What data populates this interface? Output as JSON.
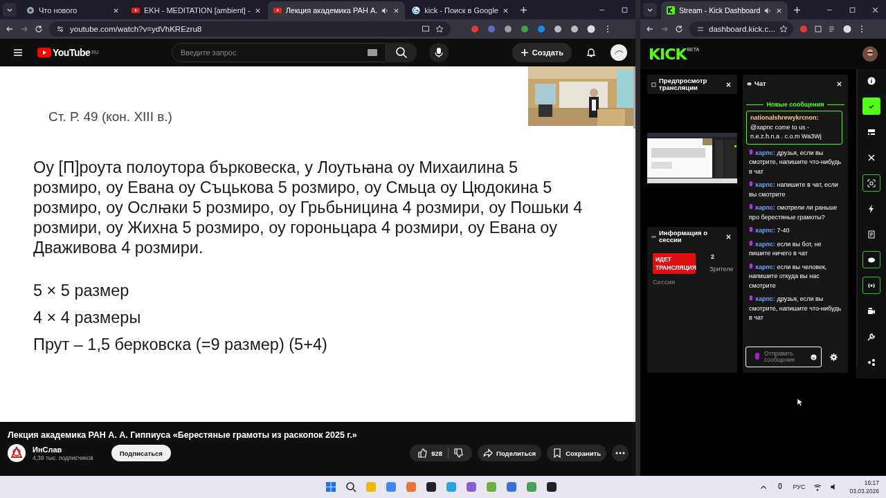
{
  "left_browser": {
    "tabs": [
      {
        "title": "Что нового",
        "selected": false,
        "audio": false,
        "kind": "chrome"
      },
      {
        "title": "EKH - MEDITATION [ambient] -",
        "selected": false,
        "audio": false,
        "kind": "youtube"
      },
      {
        "title": "Лекция академика РАН А.",
        "selected": true,
        "audio": true,
        "kind": "youtube"
      },
      {
        "title": "kick - Поиск в Google",
        "selected": false,
        "audio": false,
        "kind": "google"
      }
    ],
    "address": "youtube.com/watch?v=ydVhKREzru8"
  },
  "youtube": {
    "logo": "YouTube",
    "region": "RU",
    "search": {
      "placeholder": "Введите запрос"
    },
    "create_button": "Создать"
  },
  "slide": {
    "heading": "Ст. Р. 49 (кон. XIII в.)",
    "paragraph": "Оу [П]роута полоутора бърковеска, у Лоутьꙗна оу Михаилина 5 розмиро, оу Евана оу Съцькова 5 розмиро, оу Смьца оу Цюдокина 5 розмиро, оу Ослꙗки 5 розмиро, оу Грьбьницина 4 розмири, оу Пошьки 4 розмири, оу Жихна 5 розмиро, оу гороньцара 4 розмири, оу Евана оу Дваживова 4 розмири.",
    "lines": [
      "5 × 5 размер",
      "4 × 4 размеры",
      "Прут – 1,5 берковска (=9 размер)  (5+4)"
    ]
  },
  "video_info": {
    "title": "Лекция академика РАН А. А. Гиппиуса «Берестяные грамоты из раскопок 2025 г.»",
    "channel": "ИнСлав",
    "subscribers": "4,39 тыс. подписчиков",
    "subscribe_button": "Подписаться",
    "likes": "928",
    "share_button": "Поделиться",
    "save_button": "Сохранить"
  },
  "right_browser": {
    "tabs": [
      {
        "title": "Stream - Kick Dashboard",
        "selected": true,
        "audio": true,
        "kind": "kick"
      }
    ],
    "address": "dashboard.kick.c..."
  },
  "kick": {
    "logo": "KICK",
    "badge": "BETA"
  },
  "preview_panel": {
    "title": "Предпросмотр трансляции"
  },
  "session_panel": {
    "title": "Информация о сессии",
    "live_badge": "ИДЕТ ТРАНСЛЯЦИЯ",
    "viewers": "2",
    "viewers_label": "Зрителе",
    "session_label": "Сессия"
  },
  "chat": {
    "title": "Чат",
    "new_messages": "Новые сообщения",
    "messages": [
      {
        "user": "nationalshrewykrcnon:",
        "text": "@харпс come to us - n.e.z.h.n.a . c.o.m Wa3Wj",
        "highlighted": true
      },
      {
        "user": "харпс:",
        "text": "друзья, если вы смотрите, напишите что-нибудь в чат",
        "highlighted": false
      },
      {
        "user": "харпс:",
        "text": "напишите в чат, если вы смотрите",
        "highlighted": false
      },
      {
        "user": "харпс:",
        "text": "смотрели ли раньше про берестяные грамоты?",
        "highlighted": false
      },
      {
        "user": "харпс:",
        "text": "7-40",
        "highlighted": false
      },
      {
        "user": "харпс:",
        "text": "если вы бот, не пишите ничего в чат",
        "highlighted": false
      },
      {
        "user": "харпс:",
        "text": "если вы человек, напишите откуда вы нас смотрите",
        "highlighted": false
      },
      {
        "user": "харпс:",
        "text": "друзья, если вы смотрите, напишите что-нибудь в чат",
        "highlighted": false
      }
    ],
    "input": {
      "placeholder": "Отправить сообщение"
    }
  },
  "rail": [
    {
      "kind": "info",
      "active": false
    },
    {
      "kind": "check",
      "active": true
    },
    {
      "kind": "layout",
      "active": false
    },
    {
      "kind": "close",
      "active": false
    },
    {
      "kind": "capture",
      "active": true
    },
    {
      "kind": "bolt",
      "active": false
    },
    {
      "kind": "notes",
      "active": false
    },
    {
      "kind": "chat",
      "active": true
    },
    {
      "kind": "broadcast",
      "active": true
    },
    {
      "kind": "camera",
      "active": false
    },
    {
      "kind": "wrench",
      "active": false
    },
    {
      "kind": "share",
      "active": false
    }
  ],
  "taskbar": {
    "language": "РУС",
    "time": "16:17",
    "date": "03.03.2026"
  }
}
